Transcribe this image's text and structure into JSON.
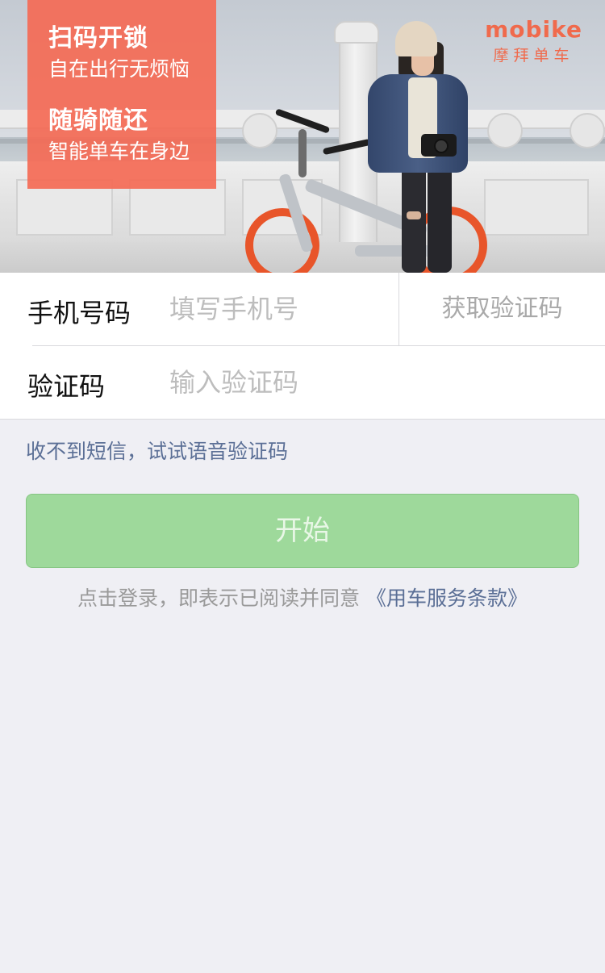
{
  "hero": {
    "promo_title_1": "扫码开锁",
    "promo_sub_1": "自在出行无烦恼",
    "promo_title_2": "随骑随还",
    "promo_sub_2": "智能单车在身边",
    "logo_en": "mobike",
    "logo_cn": "摩拜单车"
  },
  "form": {
    "phone_label": "手机号码",
    "phone_placeholder": "填写手机号",
    "get_code_label": "获取验证码",
    "code_label": "验证码",
    "code_placeholder": "输入验证码"
  },
  "voice_code_link": "收不到短信，试试语音验证码",
  "start_button": "开始",
  "agreement": {
    "text": "点击登录，即表示已阅读并同意 ",
    "terms_link": "《用车服务条款》"
  },
  "colors": {
    "brand_orange": "#f06a4c",
    "button_green": "#9ed99b",
    "link_blue": "#5b6f96",
    "background": "#efeff4"
  }
}
